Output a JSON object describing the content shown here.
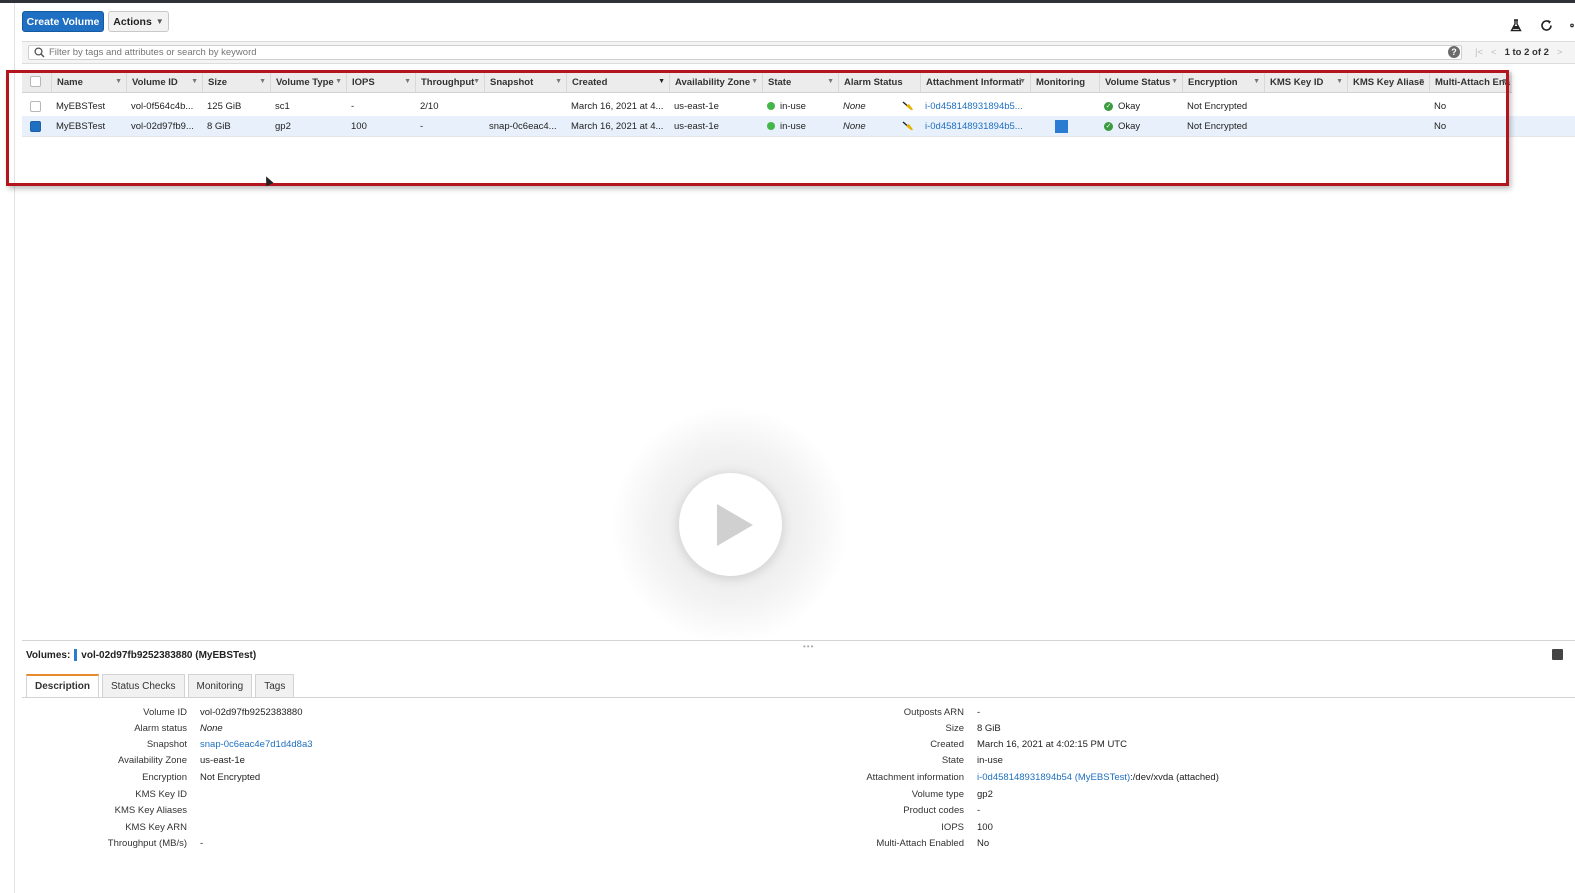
{
  "toolbar": {
    "create_label": "Create Volume",
    "actions_label": "Actions",
    "icons": [
      "flask-icon",
      "refresh-icon",
      "settings-icon"
    ]
  },
  "filter": {
    "placeholder": "Filter by tags and attributes or search by keyword",
    "pager_text": "1 to 2 of 2"
  },
  "table": {
    "columns": [
      "Name",
      "Volume ID",
      "Size",
      "Volume Type",
      "IOPS",
      "Throughput",
      "Snapshot",
      "Created",
      "Availability Zone",
      "State",
      "Alarm Status",
      "Attachment Informati",
      "Monitoring",
      "Volume Status",
      "Encryption",
      "KMS Key ID",
      "KMS Key Aliase",
      "Multi-Attach Ena"
    ],
    "rows": [
      {
        "name": "MyEBSTest",
        "volume_id": "vol-0f564c4b...",
        "size": "125 GiB",
        "type": "sc1",
        "iops": "-",
        "throughput": "2/10",
        "snapshot": "",
        "created": "March 16, 2021 at 4...",
        "az": "us-east-1e",
        "state": "in-use",
        "alarm": "None",
        "attachment": "i-0d458148931894b5...",
        "volume_status": "Okay",
        "encryption": "Not Encrypted",
        "kms_id": "",
        "kms_alias": "",
        "multi_attach": "No",
        "selected": false
      },
      {
        "name": "MyEBSTest",
        "volume_id": "vol-02d97fb9...",
        "size": "8 GiB",
        "type": "gp2",
        "iops": "100",
        "throughput": "-",
        "snapshot": "snap-0c6eac4...",
        "created": "March 16, 2021 at 4...",
        "az": "us-east-1e",
        "state": "in-use",
        "alarm": "None",
        "attachment": "i-0d458148931894b5...",
        "volume_status": "Okay",
        "encryption": "Not Encrypted",
        "kms_id": "",
        "kms_alias": "",
        "multi_attach": "No",
        "selected": true
      }
    ]
  },
  "detail": {
    "label": "Volumes:",
    "title": "vol-02d97fb9252383880 (MyEBSTest)",
    "tabs": [
      "Description",
      "Status Checks",
      "Monitoring",
      "Tags"
    ],
    "left": [
      {
        "k": "Volume ID",
        "v": "vol-02d97fb9252383880"
      },
      {
        "k": "Alarm status",
        "v": "None"
      },
      {
        "k": "Snapshot",
        "v": "snap-0c6eac4e7d1d4d8a3"
      },
      {
        "k": "Availability Zone",
        "v": "us-east-1e"
      },
      {
        "k": "Encryption",
        "v": "Not Encrypted"
      },
      {
        "k": "KMS Key ID",
        "v": ""
      },
      {
        "k": "KMS Key Aliases",
        "v": ""
      },
      {
        "k": "KMS Key ARN",
        "v": ""
      },
      {
        "k": "Throughput (MB/s)",
        "v": "-"
      }
    ],
    "right": [
      {
        "k": "Outposts ARN",
        "v": "-"
      },
      {
        "k": "Size",
        "v": "8 GiB"
      },
      {
        "k": "Created",
        "v": "March 16, 2021 at 4:02:15 PM UTC"
      },
      {
        "k": "State",
        "v": "in-use"
      },
      {
        "k": "Attachment information",
        "v_link": "i-0d458148931894b54 (MyEBSTest)",
        "v": ":/dev/xvda (attached)"
      },
      {
        "k": "Volume type",
        "v": "gp2"
      },
      {
        "k": "Product codes",
        "v": "-"
      },
      {
        "k": "IOPS",
        "v": "100"
      },
      {
        "k": "Multi-Attach Enabled",
        "v": "No"
      }
    ]
  },
  "colors": {
    "primary": "#1f6fc2",
    "highlight": "#b3141d",
    "status_green": "#45b649"
  }
}
